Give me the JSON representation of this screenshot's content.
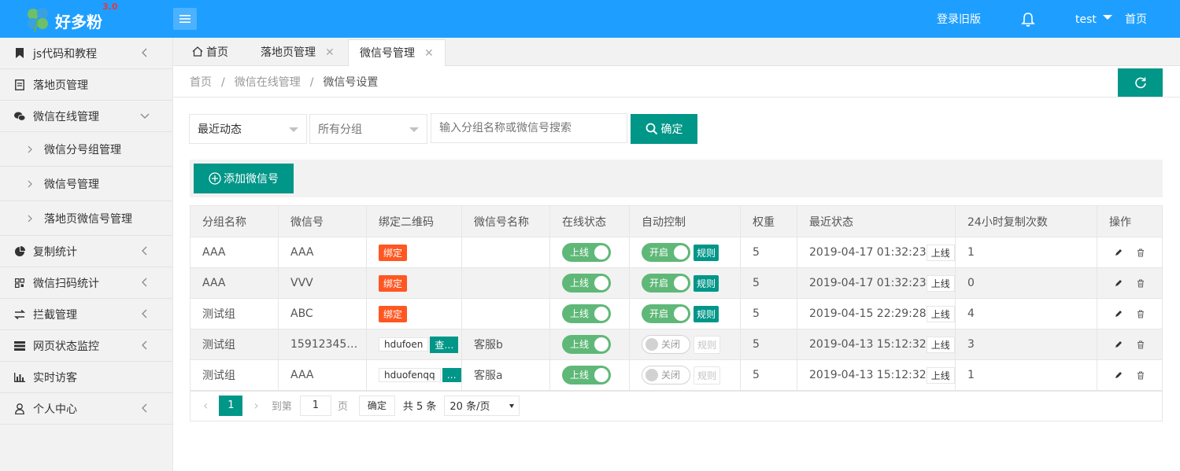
{
  "header": {
    "logo_text": "好多粉",
    "logo_version": "3.0",
    "old_version_link": "登录旧版",
    "user_name": "test",
    "home_link": "首页"
  },
  "sidebar": {
    "items": [
      {
        "label": "js代码和教程",
        "icon": "bookmark-icon"
      },
      {
        "label": "落地页管理",
        "icon": "document-icon"
      },
      {
        "label": "微信在线管理",
        "icon": "wechat-icon"
      },
      {
        "label": "复制统计",
        "icon": "pie-chart-icon"
      },
      {
        "label": "微信扫码统计",
        "icon": "qrcode-icon"
      },
      {
        "label": "拦截管理",
        "icon": "transfer-icon"
      },
      {
        "label": "网页状态监控",
        "icon": "server-icon"
      },
      {
        "label": "实时访客",
        "icon": "bar-chart-icon"
      },
      {
        "label": "个人中心",
        "icon": "user-icon"
      }
    ],
    "subitems": [
      "微信分号组管理",
      "微信号管理",
      "落地页微信号管理"
    ]
  },
  "tabs": [
    {
      "label": "首页"
    },
    {
      "label": "落地页管理"
    },
    {
      "label": "微信号管理"
    }
  ],
  "breadcrumb": [
    "首页",
    "微信在线管理",
    "微信号设置"
  ],
  "filters": {
    "sort_selected": "最近动态",
    "group_selected": "所有分组",
    "search_placeholder": "输入分组名称或微信号搜索",
    "confirm_label": "确定"
  },
  "toolbar": {
    "add_label": "添加微信号"
  },
  "table": {
    "columns": [
      "分组名称",
      "微信号",
      "绑定二维码",
      "微信号名称",
      "在线状态",
      "自动控制",
      "权重",
      "最近状态",
      "24小时复制次数",
      "操作"
    ],
    "rows": [
      {
        "group": "AAA",
        "wechat": "AAA",
        "qr_badge": "绑定",
        "qr_tag": "",
        "qr_btn": "",
        "name": "",
        "online": "上线",
        "auto": "开启",
        "auto_on": true,
        "rule": "规则",
        "weight": "5",
        "time": "2019-04-17 01:32:23",
        "status": "上线",
        "copies": "1"
      },
      {
        "group": "AAA",
        "wechat": "VVV",
        "qr_badge": "绑定",
        "qr_tag": "",
        "qr_btn": "",
        "name": "",
        "online": "上线",
        "auto": "开启",
        "auto_on": true,
        "rule": "规则",
        "weight": "5",
        "time": "2019-04-17 01:32:23",
        "status": "上线",
        "copies": "0"
      },
      {
        "group": "测试组",
        "wechat": "ABC",
        "qr_badge": "绑定",
        "qr_tag": "",
        "qr_btn": "",
        "name": "",
        "online": "上线",
        "auto": "开启",
        "auto_on": true,
        "rule": "规则",
        "weight": "5",
        "time": "2019-04-15 22:29:28",
        "status": "上线",
        "copies": "4"
      },
      {
        "group": "测试组",
        "wechat": "15912345…",
        "qr_badge": "",
        "qr_tag": "hdufoen",
        "qr_btn": "查…",
        "name": "客服b",
        "online": "上线",
        "auto": "关闭",
        "auto_on": false,
        "rule": "规则",
        "weight": "5",
        "time": "2019-04-13 15:12:32",
        "status": "上线",
        "copies": "3"
      },
      {
        "group": "测试组",
        "wechat": "AAA",
        "qr_badge": "",
        "qr_tag": "hduofenqq",
        "qr_btn": "…",
        "name": "客服a",
        "online": "上线",
        "auto": "关闭",
        "auto_on": false,
        "rule": "规则",
        "weight": "5",
        "time": "2019-04-13 15:12:32",
        "status": "上线",
        "copies": "1"
      }
    ]
  },
  "pagination": {
    "current_page": "1",
    "goto_label": "到第",
    "goto_value": "1",
    "page_unit": "页",
    "confirm_label": "确定",
    "total_label": "共 5 条",
    "page_size": "20 条/页"
  },
  "colors": {
    "primary_blue": "#1e9fff",
    "green": "#009688",
    "switch_green": "#5fb878",
    "badge_orange": "#ff5722"
  }
}
